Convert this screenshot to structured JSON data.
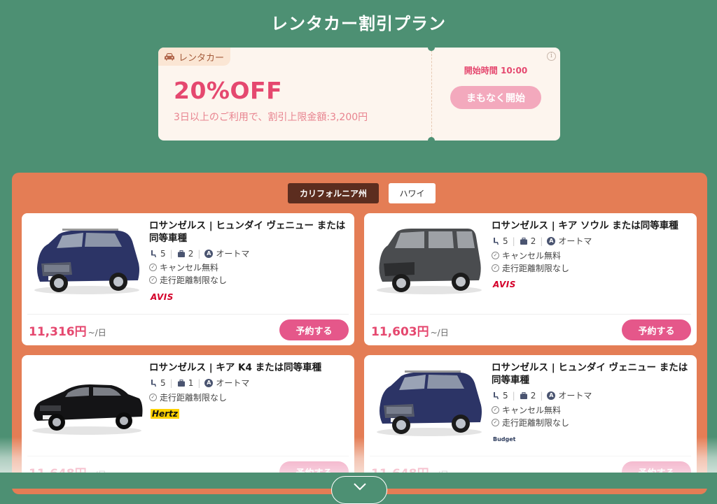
{
  "page_title": "レンタカー割引プラン",
  "coupon": {
    "tag": "レンタカー",
    "tag_icon": "car-icon",
    "discount": "20%OFF",
    "description": "3日以上のご利用で、割引上限金額:3,200円",
    "start_time": "開始時間 10:00",
    "start_button": "まもなく開始",
    "info_icon": "info-icon"
  },
  "tabs": [
    {
      "label": "カリフォルニア州",
      "active": true
    },
    {
      "label": "ハワイ",
      "active": false
    }
  ],
  "cars": [
    {
      "title": "ロサンゼルス | ヒュンダイ ヴェニュー または同等車種",
      "seats": "5",
      "bags": "2",
      "transmission": "オートマ",
      "features": [
        "キャンセル無料",
        "走行距離制限なし"
      ],
      "company": "AVIS",
      "price": "11,316円",
      "per_day": "~/日",
      "reserve": "予約する",
      "color": "#2c3466"
    },
    {
      "title": "ロサンゼルス | キア ソウル または同等車種",
      "seats": "5",
      "bags": "2",
      "transmission": "オートマ",
      "features": [
        "キャンセル無料",
        "走行距離制限なし"
      ],
      "company": "AVIS",
      "price": "11,603円",
      "per_day": "~/日",
      "reserve": "予約する",
      "color": "#4a4c4f"
    },
    {
      "title": "ロサンゼルス | キア K4 または同等車種",
      "seats": "5",
      "bags": "1",
      "transmission": "オートマ",
      "features": [
        "走行距離制限なし"
      ],
      "company": "Hertz",
      "price": "11,648円",
      "per_day": "~/日",
      "reserve": "予約する",
      "color": "#141416"
    },
    {
      "title": "ロサンゼルス | ヒュンダイ ヴェニュー または同等車種",
      "seats": "5",
      "bags": "2",
      "transmission": "オートマ",
      "features": [
        "キャンセル無料",
        "走行距離制限なし"
      ],
      "company": "Budget",
      "price": "11,648円",
      "per_day": "~/日",
      "reserve": "予約する",
      "color": "#2c3466"
    }
  ],
  "collapse_icon": "chevron-down-icon",
  "colors": {
    "background": "#4d9073",
    "panel": "#e47d55",
    "accent": "#e5486f",
    "reserve_button": "#e5578a"
  }
}
